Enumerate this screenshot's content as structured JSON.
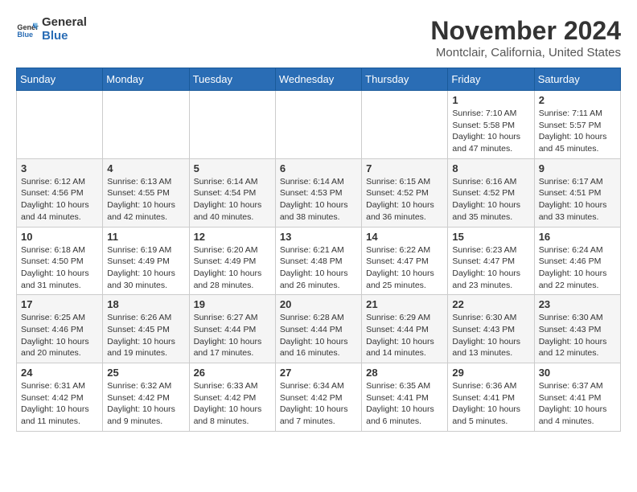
{
  "logo": {
    "line1": "General",
    "line2": "Blue"
  },
  "title": "November 2024",
  "location": "Montclair, California, United States",
  "weekdays": [
    "Sunday",
    "Monday",
    "Tuesday",
    "Wednesday",
    "Thursday",
    "Friday",
    "Saturday"
  ],
  "weeks": [
    [
      {
        "day": "",
        "info": ""
      },
      {
        "day": "",
        "info": ""
      },
      {
        "day": "",
        "info": ""
      },
      {
        "day": "",
        "info": ""
      },
      {
        "day": "",
        "info": ""
      },
      {
        "day": "1",
        "info": "Sunrise: 7:10 AM\nSunset: 5:58 PM\nDaylight: 10 hours and 47 minutes."
      },
      {
        "day": "2",
        "info": "Sunrise: 7:11 AM\nSunset: 5:57 PM\nDaylight: 10 hours and 45 minutes."
      }
    ],
    [
      {
        "day": "3",
        "info": "Sunrise: 6:12 AM\nSunset: 4:56 PM\nDaylight: 10 hours and 44 minutes."
      },
      {
        "day": "4",
        "info": "Sunrise: 6:13 AM\nSunset: 4:55 PM\nDaylight: 10 hours and 42 minutes."
      },
      {
        "day": "5",
        "info": "Sunrise: 6:14 AM\nSunset: 4:54 PM\nDaylight: 10 hours and 40 minutes."
      },
      {
        "day": "6",
        "info": "Sunrise: 6:14 AM\nSunset: 4:53 PM\nDaylight: 10 hours and 38 minutes."
      },
      {
        "day": "7",
        "info": "Sunrise: 6:15 AM\nSunset: 4:52 PM\nDaylight: 10 hours and 36 minutes."
      },
      {
        "day": "8",
        "info": "Sunrise: 6:16 AM\nSunset: 4:52 PM\nDaylight: 10 hours and 35 minutes."
      },
      {
        "day": "9",
        "info": "Sunrise: 6:17 AM\nSunset: 4:51 PM\nDaylight: 10 hours and 33 minutes."
      }
    ],
    [
      {
        "day": "10",
        "info": "Sunrise: 6:18 AM\nSunset: 4:50 PM\nDaylight: 10 hours and 31 minutes."
      },
      {
        "day": "11",
        "info": "Sunrise: 6:19 AM\nSunset: 4:49 PM\nDaylight: 10 hours and 30 minutes."
      },
      {
        "day": "12",
        "info": "Sunrise: 6:20 AM\nSunset: 4:49 PM\nDaylight: 10 hours and 28 minutes."
      },
      {
        "day": "13",
        "info": "Sunrise: 6:21 AM\nSunset: 4:48 PM\nDaylight: 10 hours and 26 minutes."
      },
      {
        "day": "14",
        "info": "Sunrise: 6:22 AM\nSunset: 4:47 PM\nDaylight: 10 hours and 25 minutes."
      },
      {
        "day": "15",
        "info": "Sunrise: 6:23 AM\nSunset: 4:47 PM\nDaylight: 10 hours and 23 minutes."
      },
      {
        "day": "16",
        "info": "Sunrise: 6:24 AM\nSunset: 4:46 PM\nDaylight: 10 hours and 22 minutes."
      }
    ],
    [
      {
        "day": "17",
        "info": "Sunrise: 6:25 AM\nSunset: 4:46 PM\nDaylight: 10 hours and 20 minutes."
      },
      {
        "day": "18",
        "info": "Sunrise: 6:26 AM\nSunset: 4:45 PM\nDaylight: 10 hours and 19 minutes."
      },
      {
        "day": "19",
        "info": "Sunrise: 6:27 AM\nSunset: 4:44 PM\nDaylight: 10 hours and 17 minutes."
      },
      {
        "day": "20",
        "info": "Sunrise: 6:28 AM\nSunset: 4:44 PM\nDaylight: 10 hours and 16 minutes."
      },
      {
        "day": "21",
        "info": "Sunrise: 6:29 AM\nSunset: 4:44 PM\nDaylight: 10 hours and 14 minutes."
      },
      {
        "day": "22",
        "info": "Sunrise: 6:30 AM\nSunset: 4:43 PM\nDaylight: 10 hours and 13 minutes."
      },
      {
        "day": "23",
        "info": "Sunrise: 6:30 AM\nSunset: 4:43 PM\nDaylight: 10 hours and 12 minutes."
      }
    ],
    [
      {
        "day": "24",
        "info": "Sunrise: 6:31 AM\nSunset: 4:42 PM\nDaylight: 10 hours and 11 minutes."
      },
      {
        "day": "25",
        "info": "Sunrise: 6:32 AM\nSunset: 4:42 PM\nDaylight: 10 hours and 9 minutes."
      },
      {
        "day": "26",
        "info": "Sunrise: 6:33 AM\nSunset: 4:42 PM\nDaylight: 10 hours and 8 minutes."
      },
      {
        "day": "27",
        "info": "Sunrise: 6:34 AM\nSunset: 4:42 PM\nDaylight: 10 hours and 7 minutes."
      },
      {
        "day": "28",
        "info": "Sunrise: 6:35 AM\nSunset: 4:41 PM\nDaylight: 10 hours and 6 minutes."
      },
      {
        "day": "29",
        "info": "Sunrise: 6:36 AM\nSunset: 4:41 PM\nDaylight: 10 hours and 5 minutes."
      },
      {
        "day": "30",
        "info": "Sunrise: 6:37 AM\nSunset: 4:41 PM\nDaylight: 10 hours and 4 minutes."
      }
    ]
  ]
}
